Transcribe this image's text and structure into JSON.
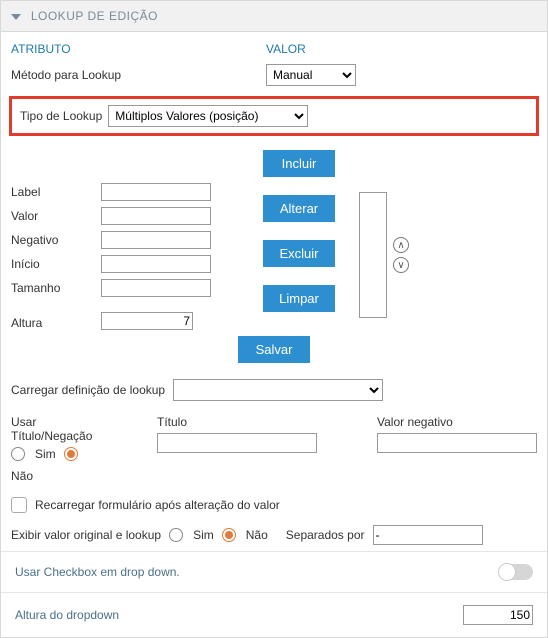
{
  "header": {
    "title": "LOOKUP DE EDIÇÃO"
  },
  "cols": {
    "attr": "ATRIBUTO",
    "val": "VALOR"
  },
  "method": {
    "label": "Método para Lookup",
    "value": "Manual"
  },
  "type": {
    "label": "Tipo de Lookup",
    "value": "Múltiplos Valores (posição)"
  },
  "fields": {
    "label": "Label",
    "valor": "Valor",
    "negativo": "Negativo",
    "inicio": "Início",
    "tamanho": "Tamanho",
    "altura": "Altura",
    "altura_val": "7"
  },
  "buttons": {
    "incluir": "Incluir",
    "alterar": "Alterar",
    "excluir": "Excluir",
    "limpar": "Limpar",
    "salvar": "Salvar"
  },
  "load": {
    "label": "Carregar definição de lookup"
  },
  "usetitle": {
    "label": "Usar Título/Negação",
    "titulo": "Título",
    "valorneg": "Valor negativo",
    "sim": "Sim",
    "nao": "Não"
  },
  "reload": {
    "label": "Recarregar formulário após alteração do valor"
  },
  "showorig": {
    "label": "Exibir valor original e lookup",
    "sim": "Sim",
    "nao": "Não",
    "sep": "Separados por",
    "sep_val": "-"
  },
  "usechk": {
    "label": "Usar Checkbox em drop down."
  },
  "ddh": {
    "label": "Altura do dropdown",
    "value": "150"
  }
}
